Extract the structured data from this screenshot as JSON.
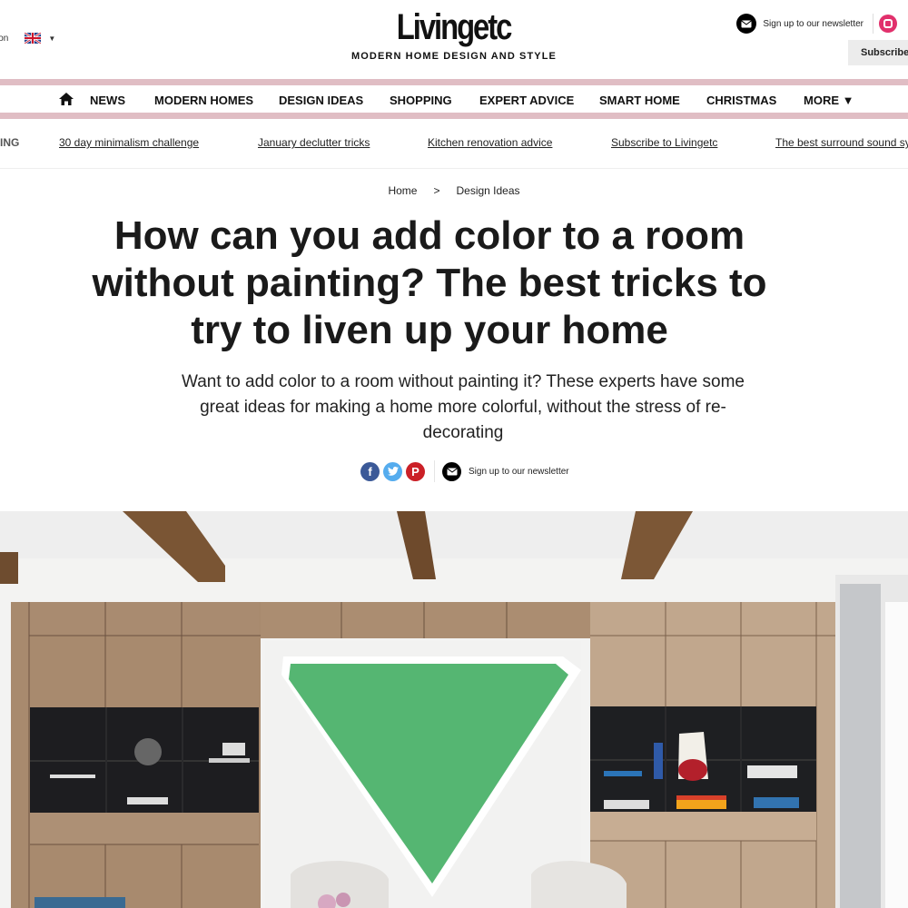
{
  "header": {
    "region_label": "ion",
    "logo": "Livingetc",
    "tagline": "MODERN HOME DESIGN AND STYLE",
    "newsletter_label": "Sign up to our newsletter",
    "subscribe_label": "Subscribe"
  },
  "nav": {
    "items": [
      {
        "label": "NEWS"
      },
      {
        "label": "MODERN HOMES"
      },
      {
        "label": "DESIGN IDEAS"
      },
      {
        "label": "SHOPPING"
      },
      {
        "label": "EXPERT ADVICE"
      },
      {
        "label": "SMART HOME"
      },
      {
        "label": "CHRISTMAS"
      },
      {
        "label": "MORE ▼"
      }
    ]
  },
  "trending": {
    "label": "ING",
    "links": [
      {
        "label": "30 day minimalism challenge"
      },
      {
        "label": "January declutter tricks"
      },
      {
        "label": "Kitchen renovation advice"
      },
      {
        "label": "Subscribe to Livingetc"
      },
      {
        "label": "The best surround sound sy"
      }
    ]
  },
  "article": {
    "breadcrumb": [
      {
        "label": "Home"
      },
      {
        "label": "Design Ideas"
      }
    ],
    "breadcrumb_separator": ">",
    "title": "How can you add color to a room without painting? The best tricks to try to liven up your home",
    "subtitle": "Want to add color to a room without painting it? These experts have some great ideas for making a home more colorful, without the stress of re-decorating",
    "share": {
      "facebook_glyph": "f",
      "pinterest_glyph": "P",
      "newsletter_label": "Sign up to our newsletter"
    },
    "hero_alt": "Living room with wooden built-in cabinets, black open shelving and a large green inverted-triangle artwork"
  },
  "colors": {
    "nav_bar": "#e0bdc4",
    "facebook": "#3b5998",
    "twitter": "#55acee",
    "pinterest": "#cb2027",
    "instagram": "#e1306c",
    "artwork_green": "#55b672"
  }
}
